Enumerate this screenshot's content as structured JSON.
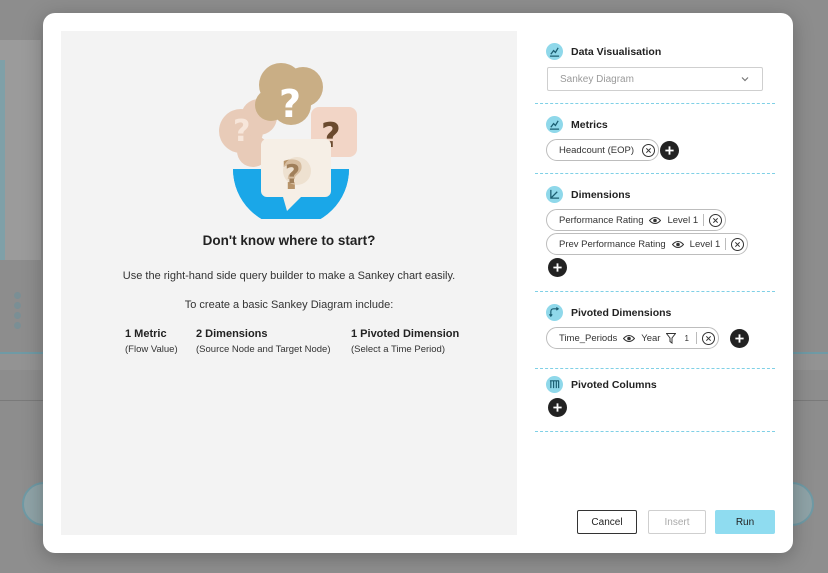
{
  "intro": {
    "heading": "Don't know where to start?",
    "line1": "Use the right-hand side query builder to make a Sankey chart easily.",
    "line2": "To create a basic Sankey Diagram include:",
    "requirements": [
      {
        "title": "1 Metric",
        "subtitle": "(Flow Value)"
      },
      {
        "title": "2 Dimensions",
        "subtitle": "(Source Node and Target Node)"
      },
      {
        "title": "1 Pivoted Dimension",
        "subtitle": "(Select a Time Period)"
      }
    ]
  },
  "data_visualisation": {
    "title": "Data Visualisation",
    "selected": "Sankey Diagram"
  },
  "metrics": {
    "title": "Metrics",
    "items": [
      {
        "label": "Headcount (EOP)"
      }
    ]
  },
  "dimensions": {
    "title": "Dimensions",
    "items": [
      {
        "label": "Performance Rating",
        "level": "Level 1"
      },
      {
        "label": "Prev Performance Rating",
        "level": "Level 1"
      }
    ]
  },
  "pivoted_dimensions": {
    "title": "Pivoted Dimensions",
    "items": [
      {
        "label": "Time_Periods",
        "level": "Year",
        "filter_count": "1"
      }
    ]
  },
  "pivoted_columns": {
    "title": "Pivoted Columns"
  },
  "buttons": {
    "cancel": "Cancel",
    "insert": "Insert",
    "run": "Run"
  },
  "colors": {
    "accent": "#8fdcf0",
    "icon_bg": "#8fd8ea",
    "divider": "#7fd0e6",
    "illustration_circle": "#1aa7e8"
  }
}
